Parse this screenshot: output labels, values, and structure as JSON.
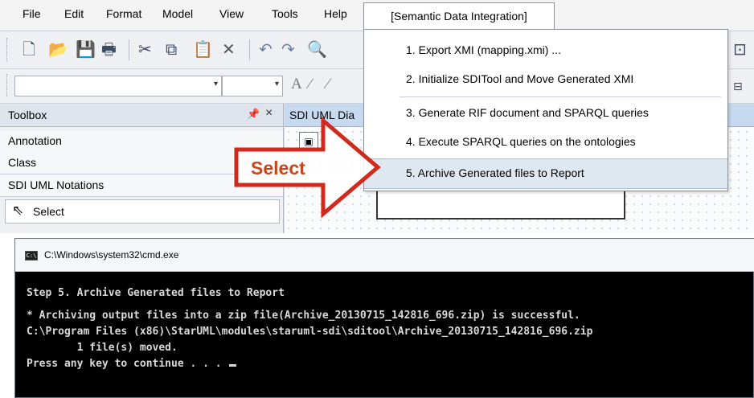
{
  "menubar": {
    "items": [
      "File",
      "Edit",
      "Format",
      "Model",
      "View",
      "Tools",
      "Help"
    ],
    "active_menu": "[Semantic Data Integration]"
  },
  "toolbar": {
    "icons": [
      "new-icon",
      "open-icon",
      "save-icon",
      "print-icon",
      "cut-icon",
      "copy-icon",
      "paste-icon",
      "delete-icon",
      "undo-icon",
      "redo-icon",
      "find-icon"
    ]
  },
  "toolbox": {
    "title": "Toolbox",
    "categories": [
      "Annotation",
      "Class",
      "SDI UML Notations"
    ],
    "select_label": "Select"
  },
  "diagram": {
    "tab_label": "SDI UML Dia"
  },
  "sdi_menu": {
    "items": [
      "1. Export XMI (mapping.xmi) ...",
      "2. Initialize SDITool and Move Generated XMI",
      "3. Generate RIF document and SPARQL queries",
      "4. Execute SPARQL queries on the ontologies",
      "5. Archive Generated files to Report"
    ],
    "highlighted_index": 4
  },
  "callout": {
    "label": "Select",
    "color": "#c8461d"
  },
  "cmd": {
    "title": "C:\\Windows\\system32\\cmd.exe",
    "lines": [
      "Step 5. Archive Generated files to Report",
      "",
      "* Archiving output files into a zip file(Archive_20130715_142816_696.zip) is successful.",
      "C:\\Program Files (x86)\\StarUML\\modules\\staruml-sdi\\sditool\\Archive_20130715_142816_696.zip",
      "        1 file(s) moved.",
      "Press any key to continue . . . "
    ]
  }
}
